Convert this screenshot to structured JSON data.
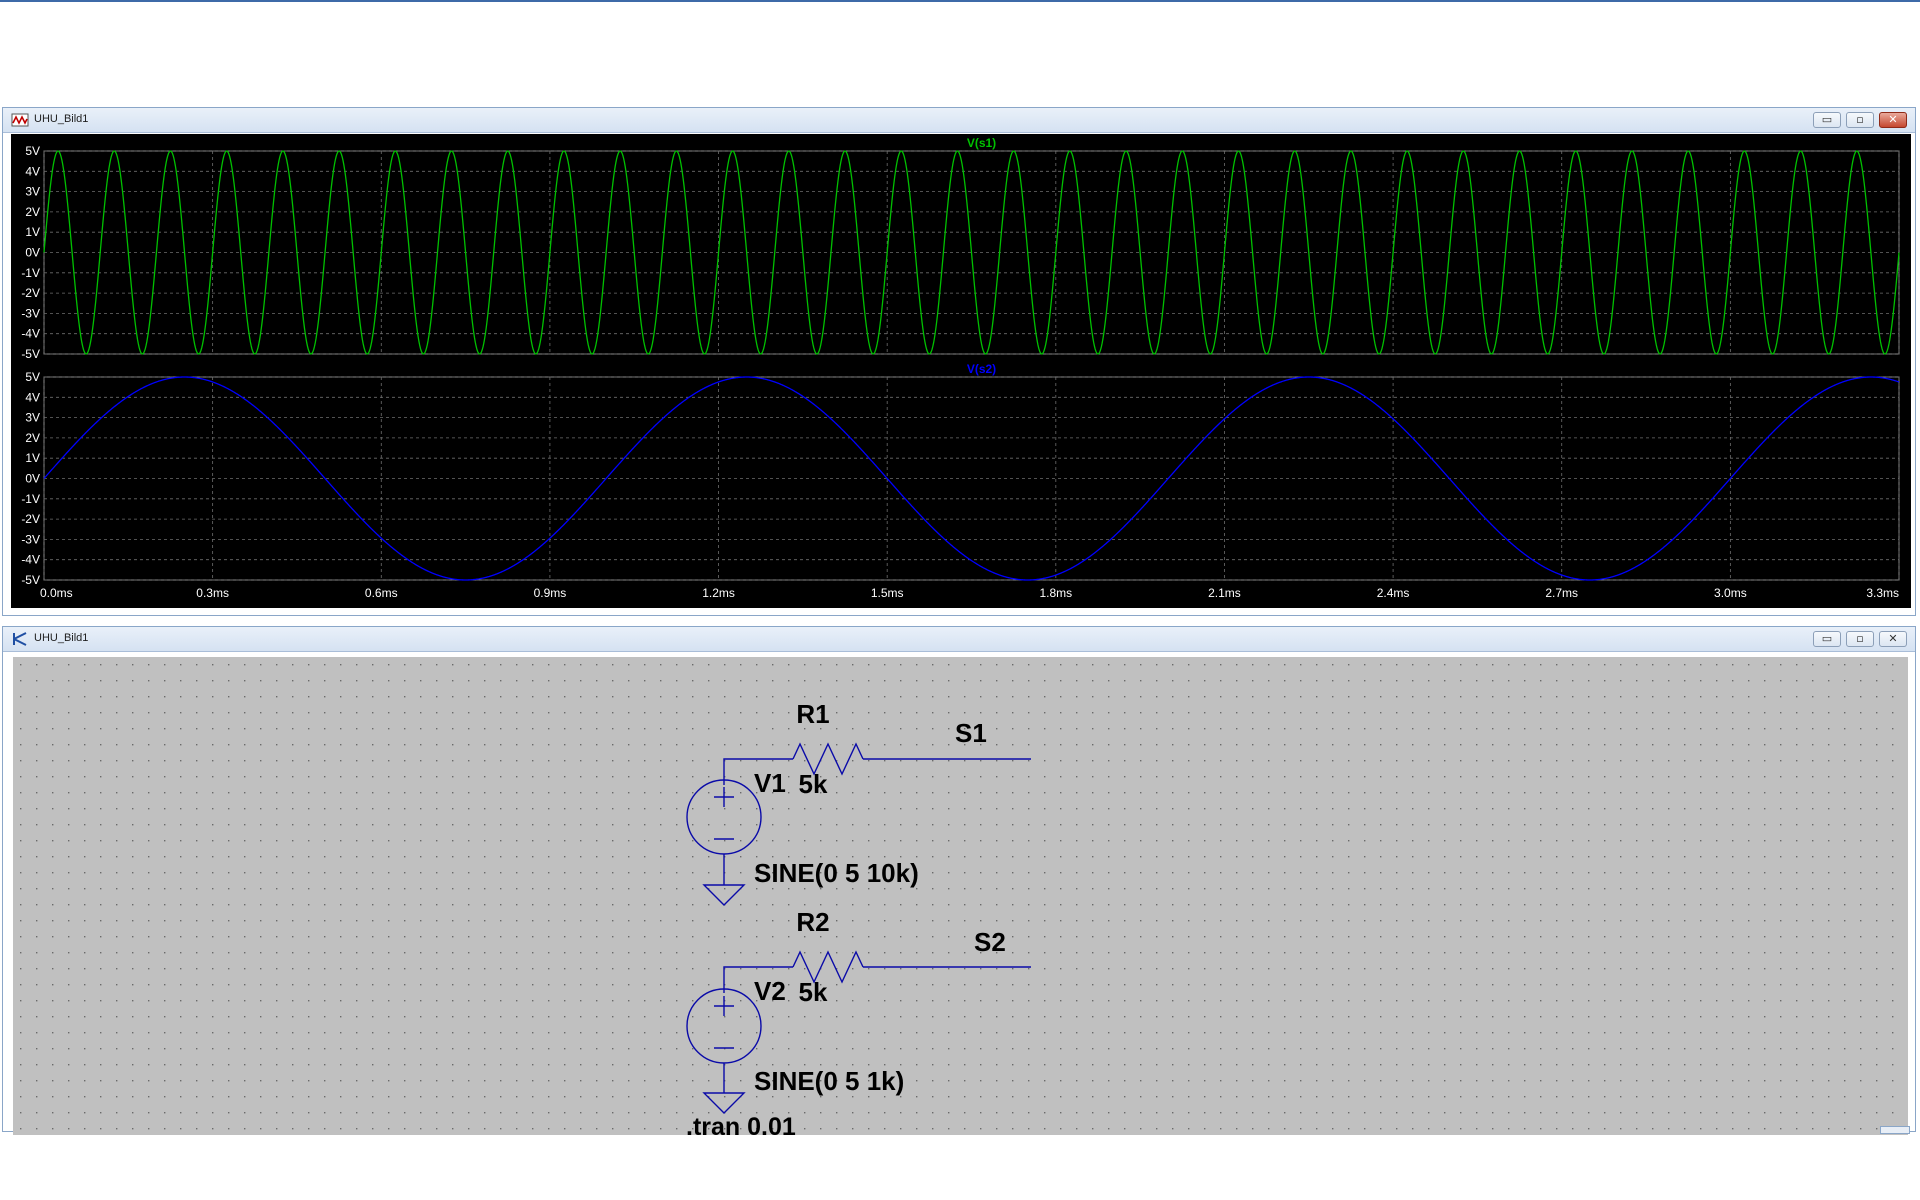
{
  "plot_window": {
    "title": "UHU_Bild1",
    "buttons": {
      "minimize": "▭",
      "restore": "▫",
      "close": "✕"
    }
  },
  "schematic_window": {
    "title": "UHU_Bild1",
    "buttons": {
      "minimize": "▭",
      "restore": "▫",
      "close": "✕"
    }
  },
  "colors": {
    "trace_s1": "#00c000",
    "trace_s2": "#0000ff",
    "plot_background": "#000000",
    "schematic_background": "#c0c0c0",
    "wire": "#0000cc"
  },
  "chart_data": [
    {
      "type": "line",
      "title": "V(s1)",
      "series": [
        {
          "name": "V(s1)",
          "function": "5*sin(2*pi*10000*t)",
          "amplitude": 5,
          "frequency_hz": 10000
        }
      ],
      "x_ticks": [
        "0.0ms",
        "0.3ms",
        "0.6ms",
        "0.9ms",
        "1.2ms",
        "1.5ms",
        "1.8ms",
        "2.1ms",
        "2.4ms",
        "2.7ms",
        "3.0ms",
        "3.3ms"
      ],
      "y_ticks": [
        "5V",
        "4V",
        "3V",
        "2V",
        "1V",
        "0V",
        "-1V",
        "-2V",
        "-3V",
        "-4V",
        "-5V"
      ],
      "xlim": [
        0,
        3.3
      ],
      "x_unit": "ms",
      "ylim": [
        -5,
        5
      ],
      "grid": true
    },
    {
      "type": "line",
      "title": "V(s2)",
      "series": [
        {
          "name": "V(s2)",
          "function": "5*sin(2*pi*1000*t)",
          "amplitude": 5,
          "frequency_hz": 1000
        }
      ],
      "x_ticks": [
        "0.0ms",
        "0.3ms",
        "0.6ms",
        "0.9ms",
        "1.2ms",
        "1.5ms",
        "1.8ms",
        "2.1ms",
        "2.4ms",
        "2.7ms",
        "3.0ms",
        "3.3ms"
      ],
      "y_ticks": [
        "5V",
        "4V",
        "3V",
        "2V",
        "1V",
        "0V",
        "-1V",
        "-2V",
        "-3V",
        "-4V",
        "-5V"
      ],
      "xlim": [
        0,
        3.3
      ],
      "x_unit": "ms",
      "ylim": [
        -5,
        5
      ],
      "grid": true
    }
  ],
  "schematic": {
    "r1": {
      "name": "R1",
      "value": "5k"
    },
    "r2": {
      "name": "R2",
      "value": "5k"
    },
    "v1": {
      "name": "V1",
      "value": "SINE(0 5 10k)"
    },
    "v2": {
      "name": "V2",
      "value": "SINE(0 5 1k)"
    },
    "net_s1": "S1",
    "net_s2": "S2",
    "directive": ".tran 0.01"
  }
}
